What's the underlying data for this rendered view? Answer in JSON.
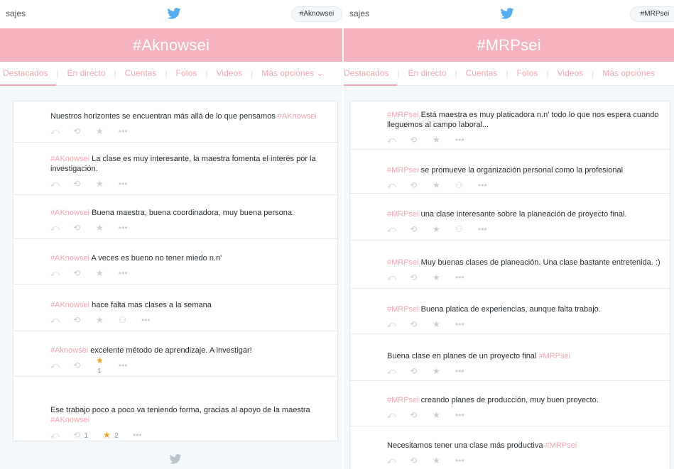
{
  "left": {
    "topbar": {
      "user": "sajes",
      "search": "#Aknowsei"
    },
    "banner": "#Aknowsei",
    "tabs": [
      "Destacados",
      "En directo",
      "Cuentas",
      "Fotos",
      "Videos",
      "Más opciones"
    ],
    "tweets": [
      {
        "pre": "Nuestros horizontes se encuentran más allá de lo que pensamos ",
        "tag": "#AKnowsei",
        "post": "",
        "likes": "",
        "retweets": "",
        "liked": false,
        "follow": false
      },
      {
        "pre": "",
        "tag": "#AKnowsei",
        "post": " La clase es muy interesante, la maestra fomenta el interés por la investigación.",
        "likes": "",
        "retweets": "",
        "liked": false,
        "follow": false
      },
      {
        "pre": "",
        "tag": "#AKnowsei",
        "post": " Buena maestra, buena coordinadora, muy buena persona.",
        "likes": "",
        "retweets": "",
        "liked": false,
        "follow": false
      },
      {
        "pre": "",
        "tag": "#AKnowsei",
        "post": " A veces es bueno no tener miedo n.n'",
        "likes": "",
        "retweets": "",
        "liked": false,
        "follow": false
      },
      {
        "pre": "",
        "tag": "#AKnowsei",
        "post": "  hace falta mas clases a la semana",
        "likes": "",
        "retweets": "",
        "liked": false,
        "follow": true
      },
      {
        "pre": "",
        "tag": "#Aknowsei",
        "post": " excelente método de aprendizaje. A investigar!",
        "likes": "1",
        "retweets": "",
        "liked": true,
        "follow": false
      },
      {
        "pre": "Ese trabajo poco a poco va teniendo forma, gracias al apoyo de la maestra ",
        "tag": "#AKnowsei",
        "post": "",
        "likes": "2",
        "retweets": "1",
        "liked": true,
        "follow": false
      }
    ]
  },
  "right": {
    "topbar": {
      "user": "sajes",
      "search": "#MRPsei"
    },
    "banner": "#MRPsei",
    "tabs": [
      "Destacados",
      "En directo",
      "Cuentas",
      "Fotos",
      "Videos",
      "Más opciones"
    ],
    "tweets": [
      {
        "pre": "",
        "tag": "#MRPsei",
        "post": " Está maestra es muy platicadora n.n' todo lo que nos espera cuando lleguemos al campo laboral...",
        "follow": false
      },
      {
        "pre": "",
        "tag": "#MRPsei",
        "post": " se promueve la organización personal como la profesional",
        "follow": true
      },
      {
        "pre": "",
        "tag": "#MRPsei",
        "post": " una clase interesante sobre la planeación de proyecto final.",
        "follow": true
      },
      {
        "pre": "",
        "tag": "#MRPsei",
        "post": " Muy buenas clases de planeación. Una clase bastante entretenida. :)",
        "follow": false
      },
      {
        "pre": "",
        "tag": "#MRPsei",
        "post": " Buena platica de experiencias, aunque falta trabajo.",
        "follow": false
      },
      {
        "pre": "Buena clase en planes de un proyecto final ",
        "tag": "#MRPsei",
        "post": "",
        "follow": false
      },
      {
        "pre": "",
        "tag": "#MRPsei",
        "post": " creando planes de producción, muy buen proyecto.",
        "follow": false
      },
      {
        "pre": "Necesitamos tener una clase más productiva ",
        "tag": "#MRPsei",
        "post": "",
        "follow": false
      }
    ]
  },
  "colors": {
    "accent": "#f4a6b3",
    "banner": "#f4b3bd",
    "star_on": "#f4a12b",
    "twitter_blue": "#55acee"
  },
  "icons": [
    "twitter-bird-icon",
    "reply-icon",
    "retweet-icon",
    "favorite-star-icon",
    "follow-user-icon",
    "more-icon"
  ]
}
